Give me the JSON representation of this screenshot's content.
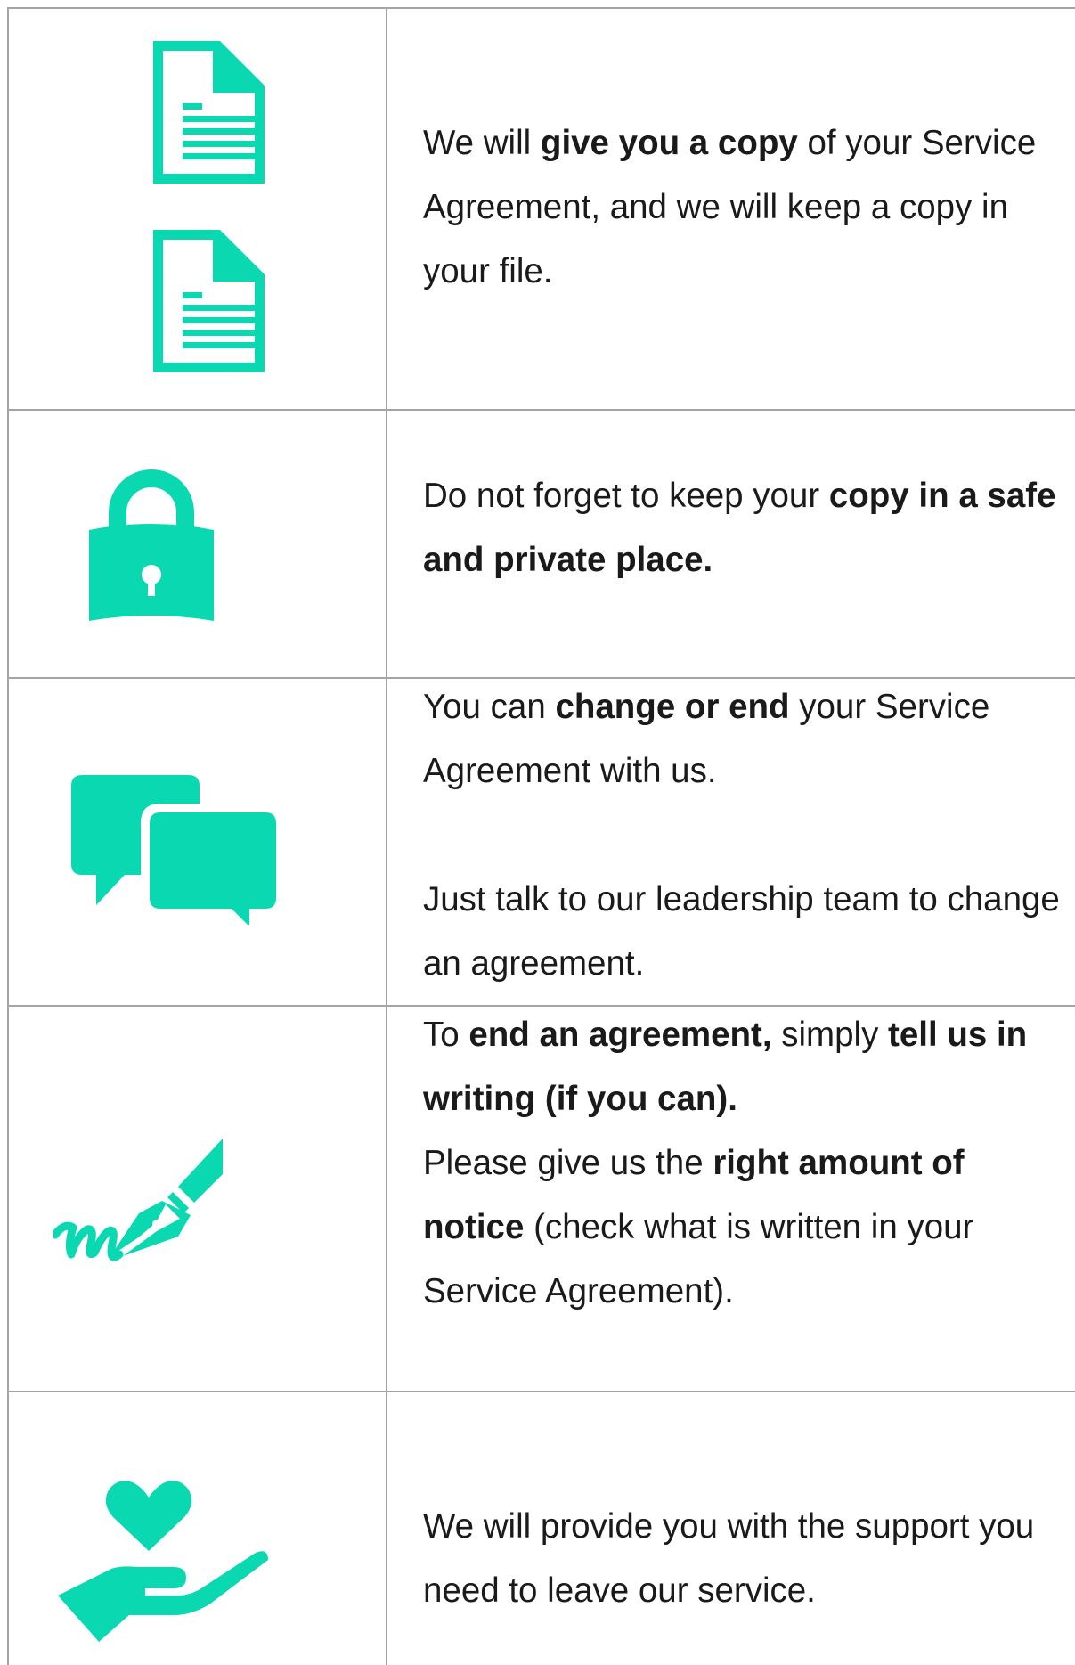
{
  "accent_color": "#0ad8b0",
  "rows": [
    {
      "icon": "documents-icon",
      "paragraphs": [
        [
          {
            "t": "We will ",
            "b": false
          },
          {
            "t": "give you a copy",
            "b": true
          },
          {
            "t": " of your Service Agreement, and we will keep a copy in your file.",
            "b": false
          }
        ]
      ]
    },
    {
      "icon": "padlock-icon",
      "paragraphs": [
        [
          {
            "t": "Do not forget to keep your ",
            "b": false
          },
          {
            "t": "copy in a safe and private place.",
            "b": true
          }
        ]
      ]
    },
    {
      "icon": "speech-bubbles-icon",
      "paragraphs": [
        [
          {
            "t": "You can ",
            "b": false
          },
          {
            "t": "change or end",
            "b": true
          },
          {
            "t": " your Service Agreement with us.",
            "b": false
          }
        ],
        [
          {
            "t": "Just talk to our leadership team to change an agreement.",
            "b": false
          }
        ]
      ]
    },
    {
      "icon": "pen-signature-icon",
      "paragraphs": [
        [
          {
            "t": "To ",
            "b": false
          },
          {
            "t": "end an agreement,",
            "b": true
          },
          {
            "t": " simply ",
            "b": false
          },
          {
            "t": "tell us in writing (if you can).",
            "b": true
          }
        ],
        [
          {
            "t": "Please give us the ",
            "b": false
          },
          {
            "t": "right amount of notice",
            "b": true
          },
          {
            "t": " (check what is written in your Service Agreement).",
            "b": false
          }
        ]
      ]
    },
    {
      "icon": "heart-in-hand-icon",
      "paragraphs": [
        [
          {
            "t": "We will provide you with the support you need to leave our service.",
            "b": false
          }
        ]
      ]
    }
  ]
}
